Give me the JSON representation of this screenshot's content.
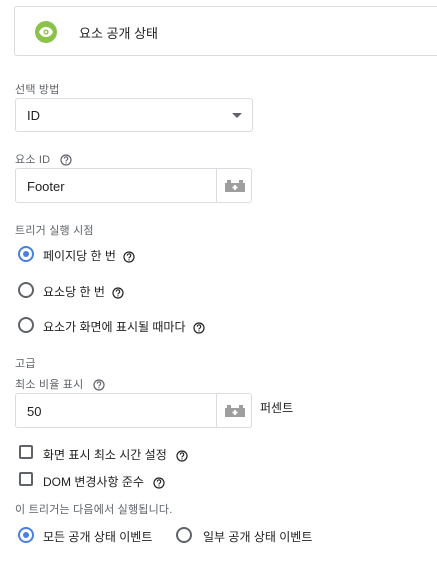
{
  "trigger": {
    "type_label": "요소 공개 상태",
    "icon": "eye-icon",
    "accent": "#8bc34a"
  },
  "selection_method": {
    "label": "선택 방법",
    "value": "ID"
  },
  "element_id": {
    "label": "요소 ID",
    "value": "Footer"
  },
  "firing_time": {
    "label": "트리거 실행 시점",
    "options": [
      {
        "label": "페이지당 한 번",
        "checked": true
      },
      {
        "label": "요소당 한 번",
        "checked": false
      },
      {
        "label": "요소가 화면에 표시될 때마다",
        "checked": false
      }
    ]
  },
  "advanced": {
    "heading": "고급",
    "min_percent": {
      "label": "최소 비율 표시",
      "value": "50",
      "unit": "퍼센트"
    },
    "checkboxes": [
      {
        "label": "화면 표시 최소 시간 설정",
        "checked": false
      },
      {
        "label": "DOM 변경사항 준수",
        "checked": false
      }
    ]
  },
  "fires_on": {
    "label": "이 트리거는 다음에서 실행됩니다.",
    "options": [
      {
        "label": "모든 공개 상태 이벤트",
        "checked": true
      },
      {
        "label": "일부 공개 상태 이벤트",
        "checked": false
      }
    ]
  },
  "colors": {
    "radio_selected": "#4a7fe0",
    "border": "#dadce0",
    "label": "#5f6368"
  }
}
